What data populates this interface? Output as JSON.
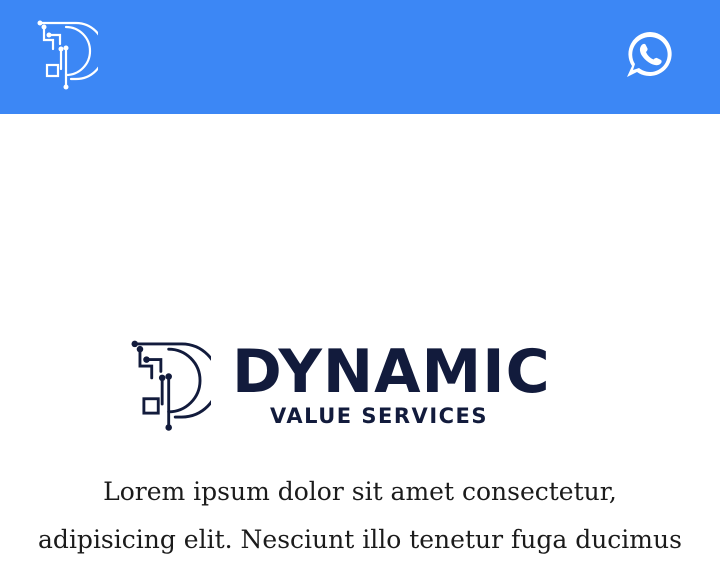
{
  "header": {
    "background_color": "#3c87f5",
    "logo_icon": "dvs-circuit-d-logo",
    "contact_icon": "whatsapp-icon"
  },
  "brand": {
    "name": "DYNAMIC",
    "tagline": "VALUE SERVICES",
    "color": "#121b3c"
  },
  "intro": {
    "line1": "Lorem ipsum dolor sit amet consectetur,",
    "line2": "adipisicing elit. Nesciunt illo tenetur fuga ducimus"
  }
}
